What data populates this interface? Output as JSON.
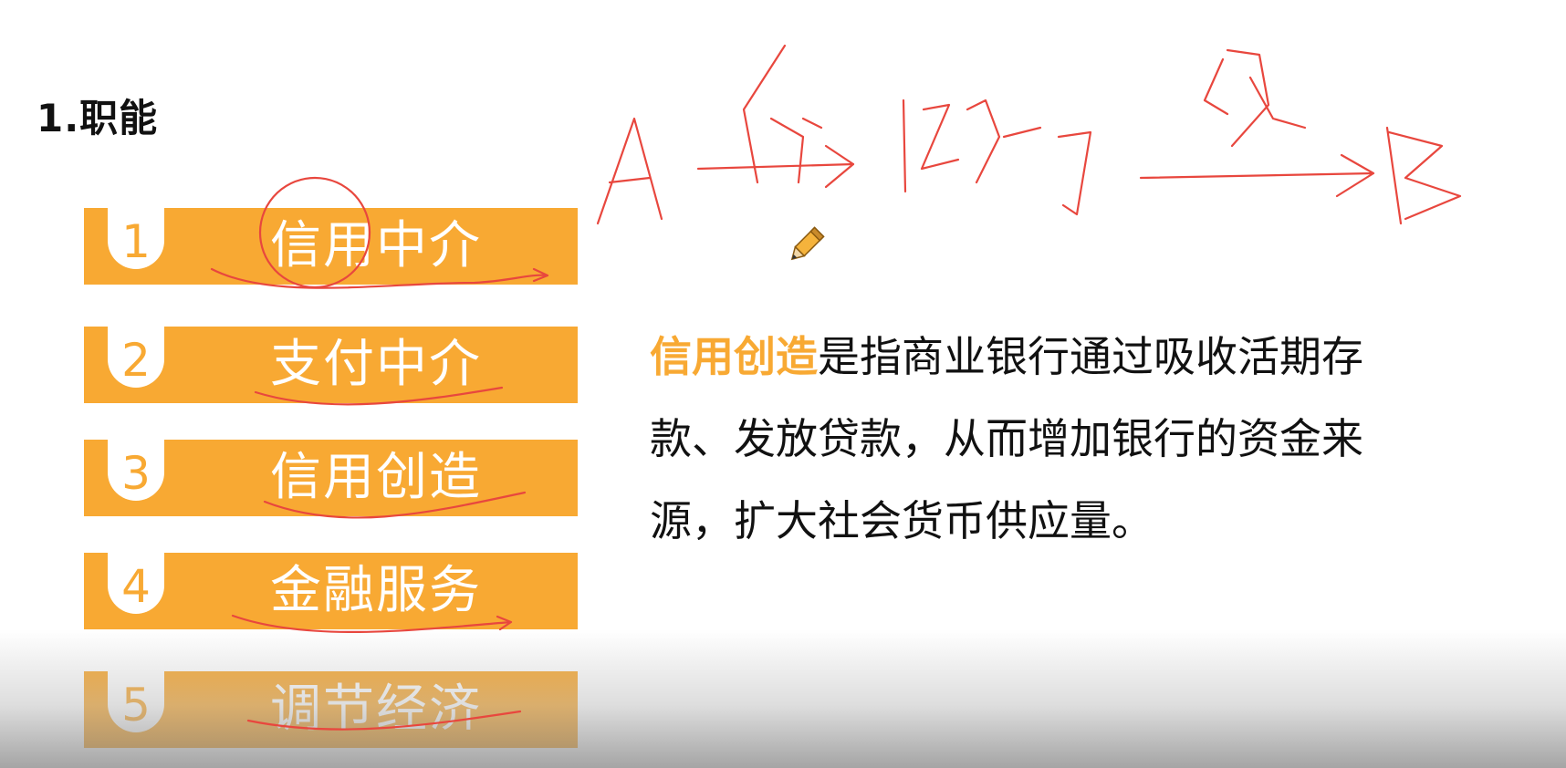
{
  "section_title": "1.职能",
  "functions": [
    {
      "num": "1",
      "label": "信用中介"
    },
    {
      "num": "2",
      "label": "支付中介"
    },
    {
      "num": "3",
      "label": "信用创造"
    },
    {
      "num": "4",
      "label": "金融服务"
    },
    {
      "num": "5",
      "label": "调节经济"
    }
  ],
  "description": {
    "highlight": "信用创造",
    "line1_rest": "是指商业银行通过吸收活期存",
    "line2": "款、发放贷款，从而增加银行的资金来",
    "line3": "源，扩大社会货币供应量。"
  },
  "colors": {
    "accent": "#f8a933",
    "ink": "#e8473e",
    "text": "#111111"
  },
  "icons": {
    "cursor": "pencil-cursor-icon"
  }
}
